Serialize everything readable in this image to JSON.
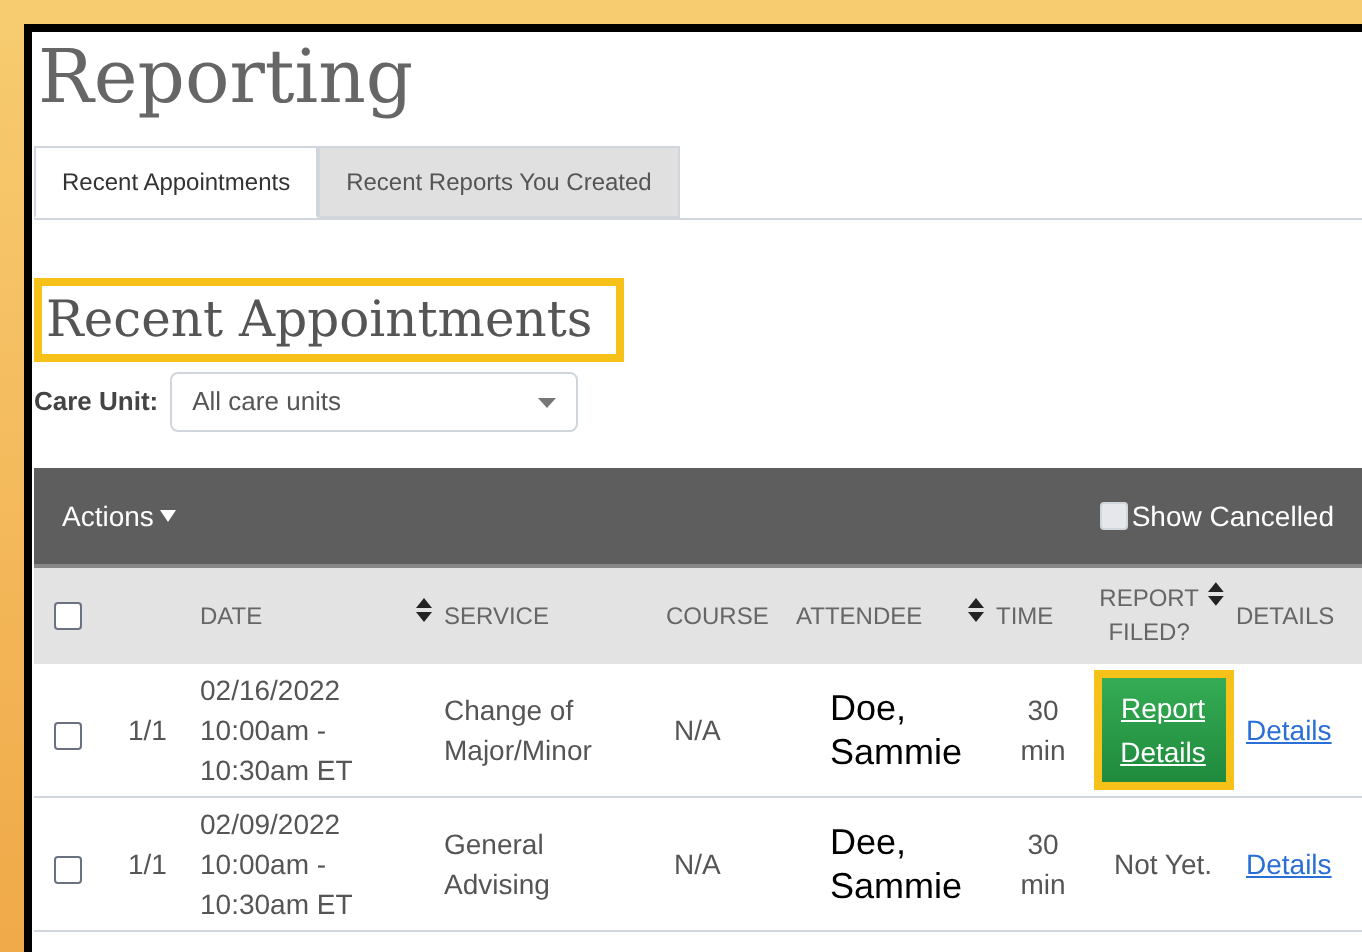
{
  "page_title": "Reporting",
  "tabs": [
    {
      "label": "Recent Appointments",
      "selected": true
    },
    {
      "label": "Recent Reports You Created",
      "selected": false
    }
  ],
  "section": {
    "heading": "Recent Appointments",
    "highlighted": true
  },
  "care_unit": {
    "label": "Care Unit:",
    "value": "All care units"
  },
  "toolbar": {
    "actions": "Actions",
    "show_cancelled": {
      "label": "Show Cancelled",
      "checked": false
    }
  },
  "table": {
    "select_all_checked": false,
    "columns": [
      {
        "label": "DATE",
        "sortable": true
      },
      {
        "label": "SERVICE",
        "sortable": false
      },
      {
        "label": "COURSE",
        "sortable": false
      },
      {
        "label": "ATTENDEE",
        "sortable": true
      },
      {
        "label": "TIME",
        "sortable": false
      },
      {
        "label": "REPORT FILED?",
        "sortable": true
      },
      {
        "label": "DETAILS",
        "sortable": false
      }
    ],
    "rows": [
      {
        "checked": false,
        "count": "1/1",
        "date": [
          "02/16/2022",
          "10:00am -",
          "10:30am ET"
        ],
        "service": "Change of Major/Minor",
        "course": "N/A",
        "attendee": "Doe, Sammie",
        "time": "30 min",
        "report": {
          "kind": "button",
          "text": "Report Details",
          "highlighted": true
        },
        "details": "Details"
      },
      {
        "checked": false,
        "count": "1/1",
        "date": [
          "02/09/2022",
          "10:00am -",
          "10:30am ET"
        ],
        "service": "General Advising",
        "course": "N/A",
        "attendee": "Dee, Sammie",
        "time": "30 min",
        "report": {
          "kind": "text",
          "text": "Not Yet.",
          "highlighted": false
        },
        "details": "Details"
      }
    ]
  }
}
